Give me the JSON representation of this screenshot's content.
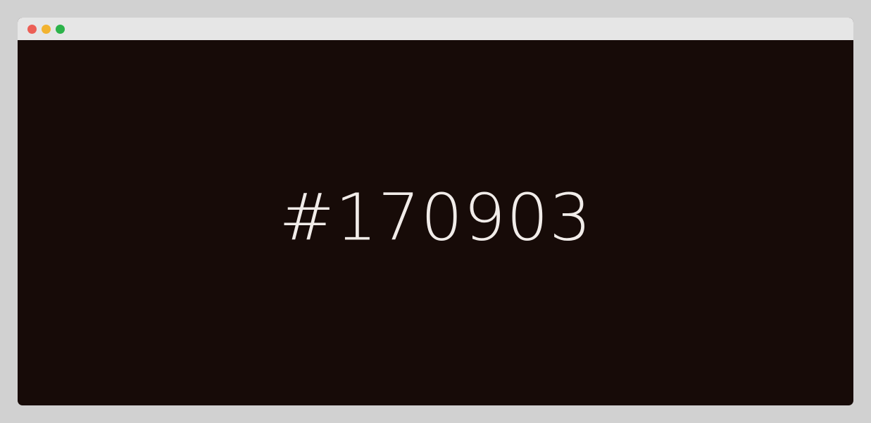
{
  "colors": {
    "page_background": "#d1d1d1",
    "titlebar": "#e6e6e6",
    "swatch": "#170b08",
    "text": "#f1ece9",
    "close_light": "#ec5f56",
    "minimize_light": "#f2b330",
    "zoom_light": "#2cb34a"
  },
  "window": {
    "controls": [
      "close",
      "minimize",
      "zoom"
    ]
  },
  "swatch": {
    "hex_label": "#170903"
  }
}
